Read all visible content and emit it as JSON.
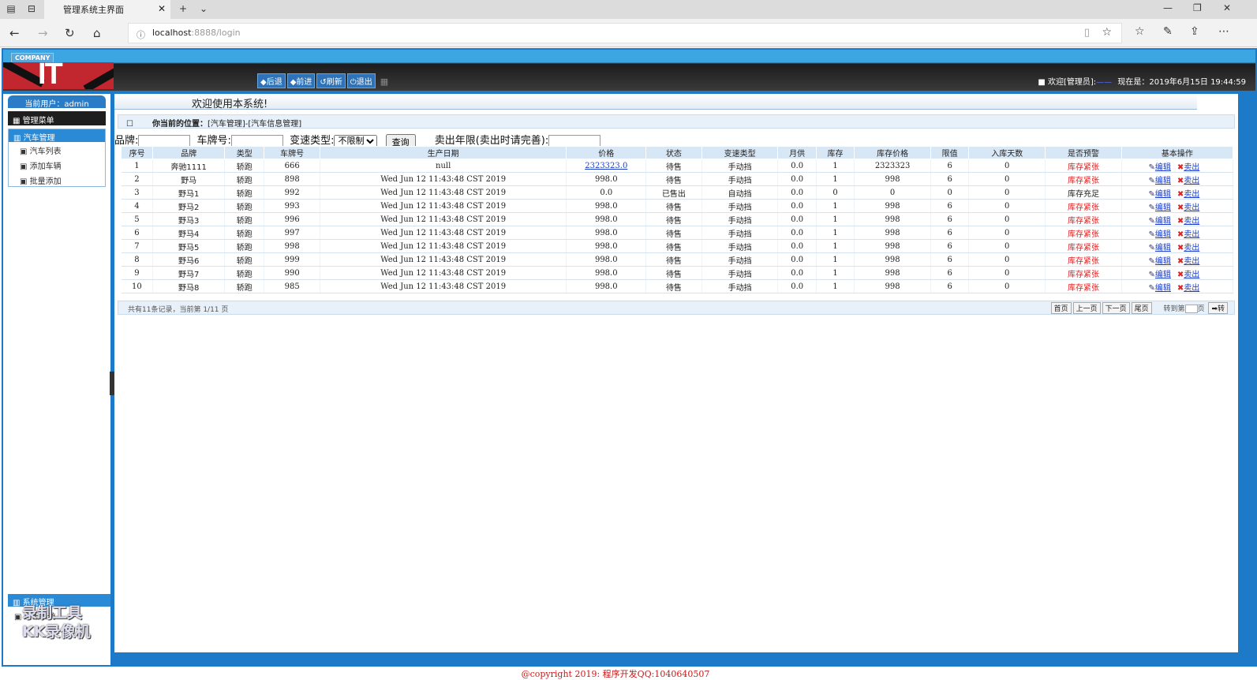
{
  "browser": {
    "tab_title": "管理系统主界面",
    "url_host": "localhost",
    "url_rest": ":8888/login"
  },
  "header": {
    "company": "COMPANY",
    "logo_text": "IT",
    "nav": [
      "◆后退",
      "◆前进",
      "↺刷新",
      "⏻退出"
    ],
    "welcome_prefix": "■ 欢迎[管理员]:",
    "welcome_user": "——",
    "now_label": "现在是：",
    "datetime": "2019年6月15日 19:44:59"
  },
  "sidebar": {
    "current_user": "当前用户：admin",
    "menu_title": "管理菜单",
    "group1": "汽车管理",
    "items": [
      "汽车列表",
      "添加车辆",
      "批量添加"
    ],
    "group2": "系统管理",
    "exit": "退出系统",
    "watermark_line1": "录制工具",
    "watermark_line2": "KK录像机"
  },
  "main": {
    "welcome": "欢迎使用本系统!",
    "location_label": "你当前的位置：",
    "location_path": "[汽车管理]-[汽车信息管理]",
    "filter": {
      "brand_label": "品牌:",
      "plate_label": "车牌号:",
      "gearbox_label": "变速类型:",
      "gearbox_value": "不限制",
      "query_button": "查询",
      "years_label": "卖出年限(卖出时请完善):"
    },
    "columns": [
      "序号",
      "品牌",
      "类型",
      "车牌号",
      "生产日期",
      "价格",
      "状态",
      "变速类型",
      "月供",
      "库存",
      "库存价格",
      "限值",
      "入库天数",
      "是否预警",
      "基本操作"
    ],
    "rows": [
      [
        "1",
        "奔驰1111",
        "轿跑",
        "666",
        "null",
        "2323323.0",
        "待售",
        "手动挡",
        "0.0",
        "1",
        "2323323",
        "6",
        "0",
        "库存紧张"
      ],
      [
        "2",
        "野马",
        "轿跑",
        "898",
        "Wed Jun 12 11:43:48 CST 2019",
        "998.0",
        "待售",
        "手动挡",
        "0.0",
        "1",
        "998",
        "6",
        "0",
        "库存紧张"
      ],
      [
        "3",
        "野马1",
        "轿跑",
        "992",
        "Wed Jun 12 11:43:48 CST 2019",
        "0.0",
        "已售出",
        "自动挡",
        "0.0",
        "0",
        "0",
        "0",
        "0",
        "库存充足"
      ],
      [
        "4",
        "野马2",
        "轿跑",
        "993",
        "Wed Jun 12 11:43:48 CST 2019",
        "998.0",
        "待售",
        "手动挡",
        "0.0",
        "1",
        "998",
        "6",
        "0",
        "库存紧张"
      ],
      [
        "5",
        "野马3",
        "轿跑",
        "996",
        "Wed Jun 12 11:43:48 CST 2019",
        "998.0",
        "待售",
        "手动挡",
        "0.0",
        "1",
        "998",
        "6",
        "0",
        "库存紧张"
      ],
      [
        "6",
        "野马4",
        "轿跑",
        "997",
        "Wed Jun 12 11:43:48 CST 2019",
        "998.0",
        "待售",
        "手动挡",
        "0.0",
        "1",
        "998",
        "6",
        "0",
        "库存紧张"
      ],
      [
        "7",
        "野马5",
        "轿跑",
        "998",
        "Wed Jun 12 11:43:48 CST 2019",
        "998.0",
        "待售",
        "手动挡",
        "0.0",
        "1",
        "998",
        "6",
        "0",
        "库存紧张"
      ],
      [
        "8",
        "野马6",
        "轿跑",
        "999",
        "Wed Jun 12 11:43:48 CST 2019",
        "998.0",
        "待售",
        "手动挡",
        "0.0",
        "1",
        "998",
        "6",
        "0",
        "库存紧张"
      ],
      [
        "9",
        "野马7",
        "轿跑",
        "990",
        "Wed Jun 12 11:43:48 CST 2019",
        "998.0",
        "待售",
        "手动挡",
        "0.0",
        "1",
        "998",
        "6",
        "0",
        "库存紧张"
      ],
      [
        "10",
        "野马8",
        "轿跑",
        "985",
        "Wed Jun 12 11:43:48 CST 2019",
        "998.0",
        "待售",
        "手动挡",
        "0.0",
        "1",
        "998",
        "6",
        "0",
        "库存紧张"
      ]
    ],
    "op_edit": "编辑",
    "op_sell": "卖出",
    "summary": "共有11条记录，当前第 1/11 页",
    "pager": {
      "first": "首页",
      "prev": "上一页",
      "next": "下一页",
      "last": "尾页",
      "goto_label": "转到第",
      "page_unit": "页",
      "go": "➡转"
    }
  },
  "footer": {
    "copyright": "@copyright 2019: 程序开发QQ:1040640507"
  },
  "colors": {
    "frame_blue": "#1d7ac8",
    "warning_red": "#e02020",
    "link_blue": "#1a3cc8"
  }
}
